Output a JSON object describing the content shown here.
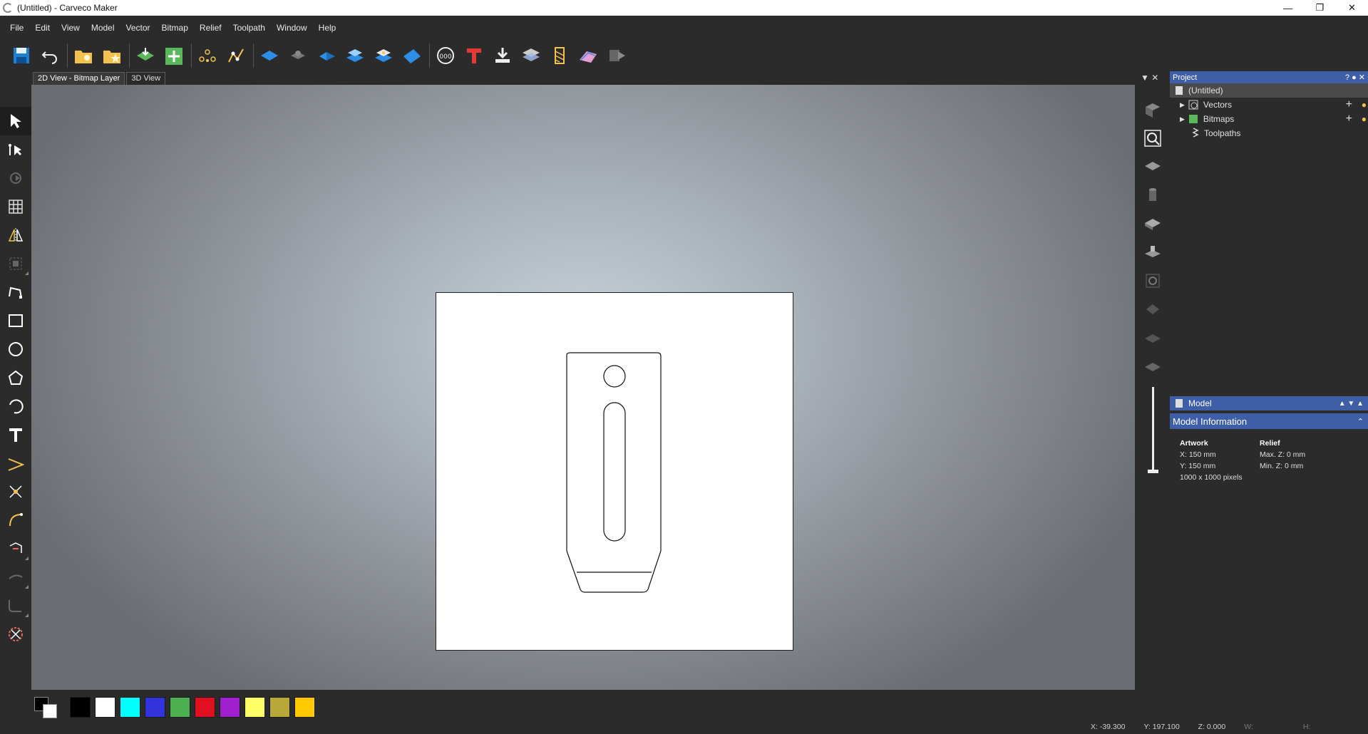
{
  "window": {
    "title": "(Untitled) - Carveco Maker"
  },
  "menu": [
    "File",
    "Edit",
    "View",
    "Model",
    "Vector",
    "Bitmap",
    "Relief",
    "Toolpath",
    "Window",
    "Help"
  ],
  "tabs": {
    "bitmap_view": "2D View - Bitmap Layer",
    "view_3d": "3D View"
  },
  "project": {
    "title": "Project",
    "root": "(Untitled)",
    "items": [
      "Vectors",
      "Bitmaps",
      "Toolpaths"
    ]
  },
  "model": {
    "title": "Model",
    "info_title": "Model Information",
    "artwork": {
      "heading": "Artwork",
      "x": "X: 150 mm",
      "y": "Y: 150 mm",
      "pixels": "1000 x 1000 pixels"
    },
    "relief": {
      "heading": "Relief",
      "max_z": "Max. Z: 0 mm",
      "min_z": "Min. Z: 0 mm"
    }
  },
  "palette": [
    "#000000",
    "#ffffff",
    "#00ffff",
    "#3333dd",
    "#4caf50",
    "#e01020",
    "#a020d0",
    "#ffff66",
    "#b8a838",
    "#ffc800"
  ],
  "status": {
    "x": "X: -39.300",
    "y": "Y: 197.100",
    "z": "Z: 0.000",
    "w": "W:",
    "h": "H:"
  },
  "colors": {
    "accent": "#3e5ea8",
    "background": "#2b2b2b"
  }
}
